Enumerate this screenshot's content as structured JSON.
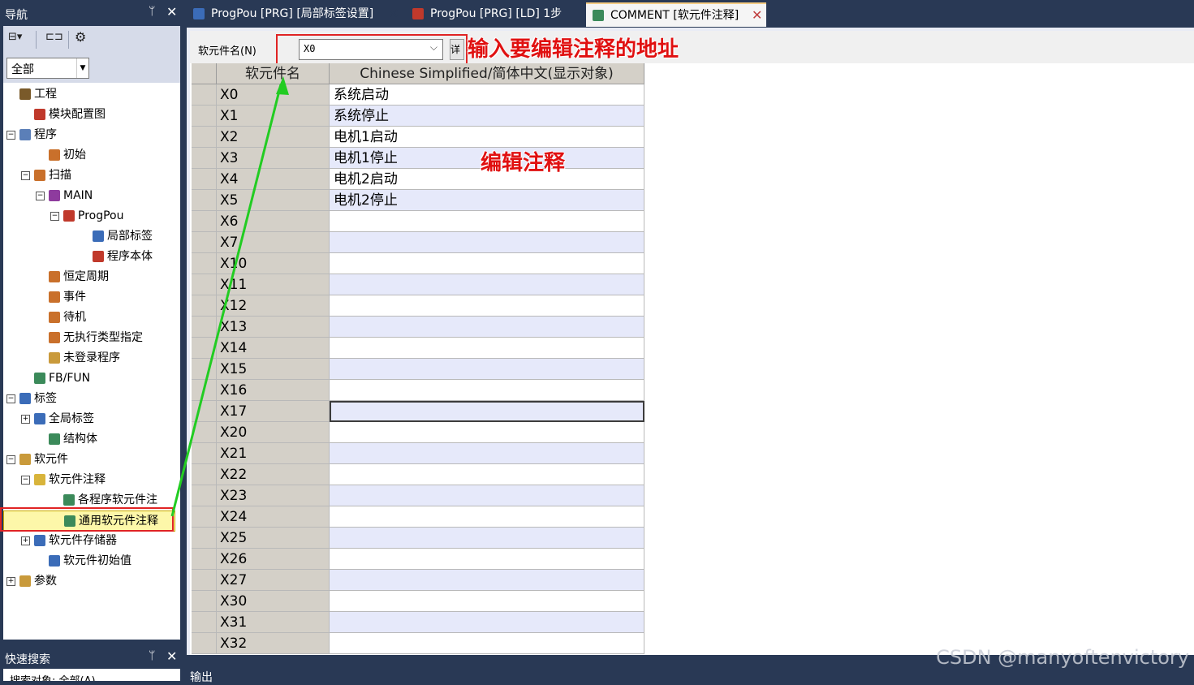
{
  "navigation": {
    "title": "导航",
    "pin": "ᛘ",
    "close": "✕",
    "filter": "全部",
    "tree": [
      {
        "label": "工程",
        "depth": 0,
        "expander": "",
        "icon": "project-icon",
        "color": "#7a5a2a"
      },
      {
        "label": "模块配置图",
        "depth": 1,
        "expander": "",
        "icon": "module-config-icon",
        "color": "#c0392b"
      },
      {
        "label": "程序",
        "depth": 0,
        "expander": "−",
        "icon": "program-folder-icon",
        "color": "#5b7fb8"
      },
      {
        "label": "初始",
        "depth": 2,
        "expander": "",
        "icon": "program-type-icon",
        "color": "#c9702b"
      },
      {
        "label": "扫描",
        "depth": 1,
        "expander": "−",
        "icon": "program-type-icon",
        "color": "#c9702b"
      },
      {
        "label": "MAIN",
        "depth": 2,
        "expander": "−",
        "icon": "task-icon",
        "color": "#8e3b9e"
      },
      {
        "label": "ProgPou",
        "depth": 3,
        "expander": "−",
        "icon": "pou-icon",
        "color": "#c0392b"
      },
      {
        "label": "局部标签",
        "depth": 5,
        "expander": "",
        "icon": "local-label-icon",
        "color": "#3b6cb8"
      },
      {
        "label": "程序本体",
        "depth": 5,
        "expander": "",
        "icon": "program-body-icon",
        "color": "#c0392b"
      },
      {
        "label": "恒定周期",
        "depth": 2,
        "expander": "",
        "icon": "program-type-icon",
        "color": "#c9702b"
      },
      {
        "label": "事件",
        "depth": 2,
        "expander": "",
        "icon": "program-type-icon",
        "color": "#c9702b"
      },
      {
        "label": "待机",
        "depth": 2,
        "expander": "",
        "icon": "program-type-icon",
        "color": "#c9702b"
      },
      {
        "label": "无执行类型指定",
        "depth": 2,
        "expander": "",
        "icon": "program-type-icon",
        "color": "#c9702b"
      },
      {
        "label": "未登录程序",
        "depth": 2,
        "expander": "",
        "icon": "unregistered-program-icon",
        "color": "#c99a3b"
      },
      {
        "label": "FB/FUN",
        "depth": 1,
        "expander": "",
        "icon": "fb-fun-icon",
        "color": "#3b8a5a"
      },
      {
        "label": "标签",
        "depth": 0,
        "expander": "−",
        "icon": "label-folder-icon",
        "color": "#3b6cb8"
      },
      {
        "label": "全局标签",
        "depth": 1,
        "expander": "+",
        "icon": "global-label-icon",
        "color": "#3b6cb8"
      },
      {
        "label": "结构体",
        "depth": 2,
        "expander": "",
        "icon": "struct-icon",
        "color": "#3b8a5a"
      },
      {
        "label": "软元件",
        "depth": 0,
        "expander": "−",
        "icon": "device-folder-icon",
        "color": "#c99a3b"
      },
      {
        "label": "软元件注释",
        "depth": 1,
        "expander": "−",
        "icon": "device-comment-icon",
        "color": "#d8b43b"
      },
      {
        "label": "各程序软元件注",
        "depth": 3,
        "expander": "",
        "icon": "program-comment-icon",
        "color": "#3b8a5a"
      },
      {
        "label": "通用软元件注释",
        "depth": 3,
        "expander": "",
        "icon": "common-comment-icon",
        "color": "#3b8a5a",
        "selected": true
      },
      {
        "label": "软元件存储器",
        "depth": 1,
        "expander": "+",
        "icon": "device-memory-icon",
        "color": "#3b6cb8"
      },
      {
        "label": "软元件初始值",
        "depth": 2,
        "expander": "",
        "icon": "device-initial-icon",
        "color": "#3b6cb8"
      },
      {
        "label": "参数",
        "depth": 0,
        "expander": "+",
        "icon": "parameter-icon",
        "color": "#c99a3b"
      }
    ]
  },
  "tabs": [
    {
      "label": "ProgPou [PRG] [局部标签设置]",
      "icon": "local-label-icon",
      "color": "#3b6cb8",
      "close": "✕",
      "active": false
    },
    {
      "label": "ProgPou [PRG] [LD] 1步",
      "icon": "program-body-icon",
      "color": "#c0392b",
      "close": "",
      "active": false
    },
    {
      "label": "COMMENT [软元件注释]",
      "icon": "common-comment-icon",
      "color": "#3b8a5a",
      "close": "✕",
      "active": true
    }
  ],
  "editor": {
    "device_label": "软元件名(N)",
    "device_value": "X0",
    "detail_button": "详细",
    "columns": [
      "软元件名",
      "Chinese Simplified/简体中文(显示对象)"
    ],
    "rows": [
      {
        "device": "X0",
        "comment": "系统启动"
      },
      {
        "device": "X1",
        "comment": "系统停止"
      },
      {
        "device": "X2",
        "comment": "电机1启动"
      },
      {
        "device": "X3",
        "comment": "电机1停止"
      },
      {
        "device": "X4",
        "comment": "电机2启动"
      },
      {
        "device": "X5",
        "comment": "电机2停止"
      },
      {
        "device": "X6",
        "comment": ""
      },
      {
        "device": "X7",
        "comment": ""
      },
      {
        "device": "X10",
        "comment": ""
      },
      {
        "device": "X11",
        "comment": ""
      },
      {
        "device": "X12",
        "comment": ""
      },
      {
        "device": "X13",
        "comment": ""
      },
      {
        "device": "X14",
        "comment": ""
      },
      {
        "device": "X15",
        "comment": ""
      },
      {
        "device": "X16",
        "comment": ""
      },
      {
        "device": "X17",
        "comment": "",
        "active": true
      },
      {
        "device": "X20",
        "comment": ""
      },
      {
        "device": "X21",
        "comment": ""
      },
      {
        "device": "X22",
        "comment": ""
      },
      {
        "device": "X23",
        "comment": ""
      },
      {
        "device": "X24",
        "comment": ""
      },
      {
        "device": "X25",
        "comment": ""
      },
      {
        "device": "X26",
        "comment": ""
      },
      {
        "device": "X27",
        "comment": ""
      },
      {
        "device": "X30",
        "comment": ""
      },
      {
        "device": "X31",
        "comment": ""
      },
      {
        "device": "X32",
        "comment": ""
      }
    ]
  },
  "annotations": {
    "address_hint": "输入要编辑注释的地址",
    "edit_hint": "编辑注释",
    "highlight_color": "#e02424",
    "arrow_color": "#22cc22"
  },
  "quick_search": {
    "title": "快速搜索",
    "pin": "ᛘ",
    "close": "✕",
    "target": "搜索对象: 全部(A)"
  },
  "output": {
    "title": "输出"
  },
  "watermark": "CSDN @manyoftenvictory"
}
